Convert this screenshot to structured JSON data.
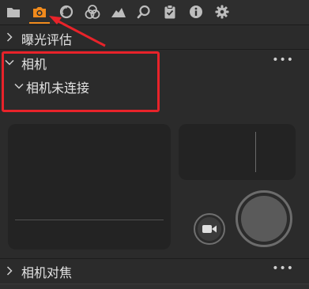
{
  "toolbar": {
    "tools": [
      {
        "icon": "folder-icon",
        "active": false
      },
      {
        "icon": "camera-icon",
        "active": true
      },
      {
        "icon": "circle-icon",
        "active": false
      },
      {
        "icon": "color-circles-icon",
        "active": false
      },
      {
        "icon": "mountain-icon",
        "active": false
      },
      {
        "icon": "search-icon",
        "active": false
      },
      {
        "icon": "clipboard-icon",
        "active": false
      },
      {
        "icon": "info-icon",
        "active": false
      },
      {
        "icon": "gear-icon",
        "active": false
      }
    ],
    "accent_color": "#f08a1c"
  },
  "sections": {
    "exposure": {
      "title": "曝光评估"
    },
    "camera": {
      "title": "相机",
      "menu": "•••",
      "status": "相机未连接"
    },
    "focus": {
      "title": "相机对焦",
      "menu": "•••"
    }
  },
  "annotation": {
    "color": "#e8232a"
  }
}
